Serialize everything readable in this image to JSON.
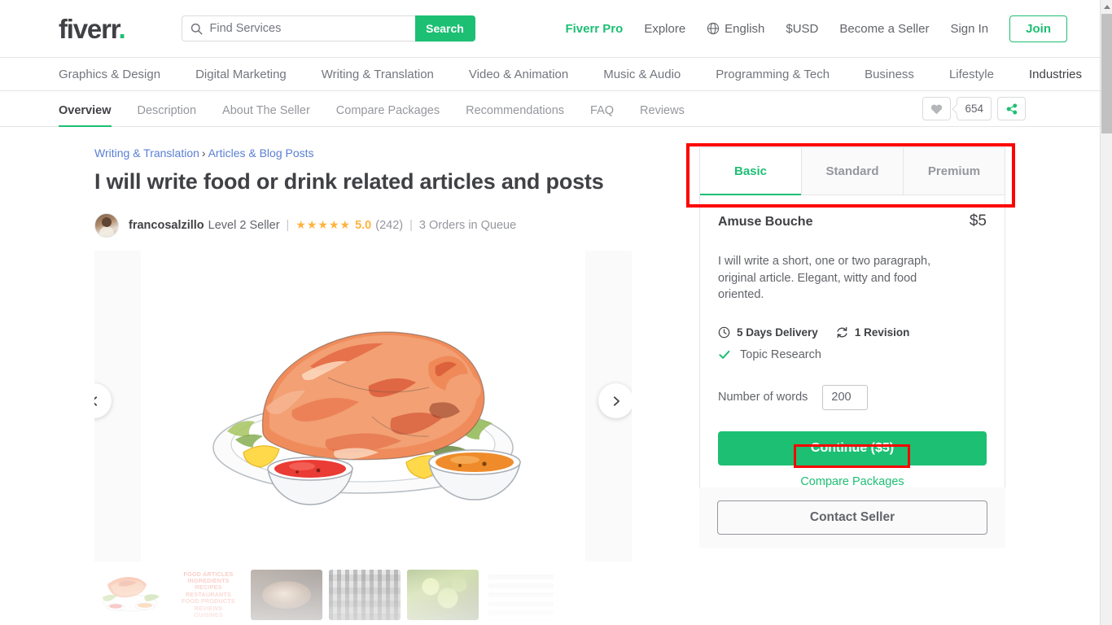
{
  "header": {
    "logo_text": "fiverr",
    "logo_dot": ".",
    "search": {
      "placeholder": "Find Services",
      "value": "",
      "button_label": "Search",
      "icon": "search-icon"
    },
    "right_links": [
      {
        "label": "Fiverr Pro",
        "style": "pro"
      },
      {
        "label": "Explore",
        "style": "plain"
      },
      {
        "label": "English",
        "style": "lang",
        "icon": "globe-icon"
      },
      {
        "label": "$USD",
        "style": "plain"
      },
      {
        "label": "Become a Seller",
        "style": "plain"
      },
      {
        "label": "Sign In",
        "style": "plain"
      }
    ],
    "join_label": "Join"
  },
  "category_nav": [
    {
      "label": "Graphics & Design",
      "active": false
    },
    {
      "label": "Digital Marketing",
      "active": false
    },
    {
      "label": "Writing & Translation",
      "active": false
    },
    {
      "label": "Video & Animation",
      "active": false
    },
    {
      "label": "Music & Audio",
      "active": false
    },
    {
      "label": "Programming & Tech",
      "active": false
    },
    {
      "label": "Business",
      "active": false
    },
    {
      "label": "Lifestyle",
      "active": false
    },
    {
      "label": "Industries",
      "active": true
    }
  ],
  "gig_nav": {
    "tabs": [
      {
        "label": "Overview",
        "active": true
      },
      {
        "label": "Description",
        "active": false
      },
      {
        "label": "About The Seller",
        "active": false
      },
      {
        "label": "Compare Packages",
        "active": false
      },
      {
        "label": "Recommendations",
        "active": false
      },
      {
        "label": "FAQ",
        "active": false
      },
      {
        "label": "Reviews",
        "active": false
      }
    ],
    "favorite_icon": "heart-icon",
    "favorite_count": "654",
    "share_icon": "share-icon"
  },
  "gig": {
    "breadcrumb": {
      "category": "Writing & Translation",
      "separator": "›",
      "subcategory": "Articles & Blog Posts"
    },
    "title": "I will write food or drink related articles and posts",
    "seller": {
      "avatar": "seller-avatar",
      "username": "francosalzillo",
      "level": "Level 2 Seller",
      "divider": "|",
      "stars": "★★★★★",
      "rating": "5.0",
      "review_count": "(242)",
      "divider2": "|",
      "orders_in_queue": "3 Orders in Queue"
    }
  },
  "gallery": {
    "prev_icon": "chevron-left-icon",
    "next_icon": "chevron-right-icon",
    "main_image_alt": "watercolor-roast-turkey-illustration",
    "thumbnails": [
      {
        "name": "thumb-roast-turkey",
        "label": ""
      },
      {
        "name": "thumb-food-keywords",
        "label": "FOOD ARTICLES\nINGREDIENTS\nRECIPES\nRESTAURANTS\nFOOD PRODUCTS\nREVIEWS\nCUISINES"
      },
      {
        "name": "thumb-steak-plate",
        "label": ""
      },
      {
        "name": "thumb-bw-crowd",
        "label": ""
      },
      {
        "name": "thumb-grape-vine",
        "label": ""
      },
      {
        "name": "thumb-table",
        "label": ""
      }
    ]
  },
  "package": {
    "tabs": [
      {
        "label": "Basic",
        "active": true
      },
      {
        "label": "Standard",
        "active": false
      },
      {
        "label": "Premium",
        "active": false
      }
    ],
    "name": "Amuse Bouche",
    "price": "$5",
    "description": "I will write a short, one or two paragraph, original article. Elegant, witty and food oriented.",
    "delivery": {
      "icon": "clock-icon",
      "label": "5 Days Delivery"
    },
    "revisions": {
      "icon": "refresh-icon",
      "label": "1 Revision"
    },
    "features": [
      {
        "icon": "check-icon",
        "label": "Topic Research"
      }
    ],
    "words": {
      "label": "Number of words",
      "value": "200",
      "placeholder": "200"
    },
    "continue_label": "Continue ($5)",
    "compare_label": "Compare Packages"
  },
  "contact": {
    "button_label": "Contact Seller"
  },
  "annotations": [
    {
      "name": "annotation-package-tabs",
      "target": "package-tabs",
      "color": "#ff0000"
    },
    {
      "name": "annotation-compare-packages",
      "target": "compare-packages-link",
      "color": "#ff0000"
    }
  ],
  "colors": {
    "brand_green": "#1dbf73",
    "text_dark": "#404145",
    "text_muted": "#74767e",
    "star_gold": "#ffb33e",
    "link_blue": "#5a7fd4",
    "annotation_red": "#ff0000"
  }
}
